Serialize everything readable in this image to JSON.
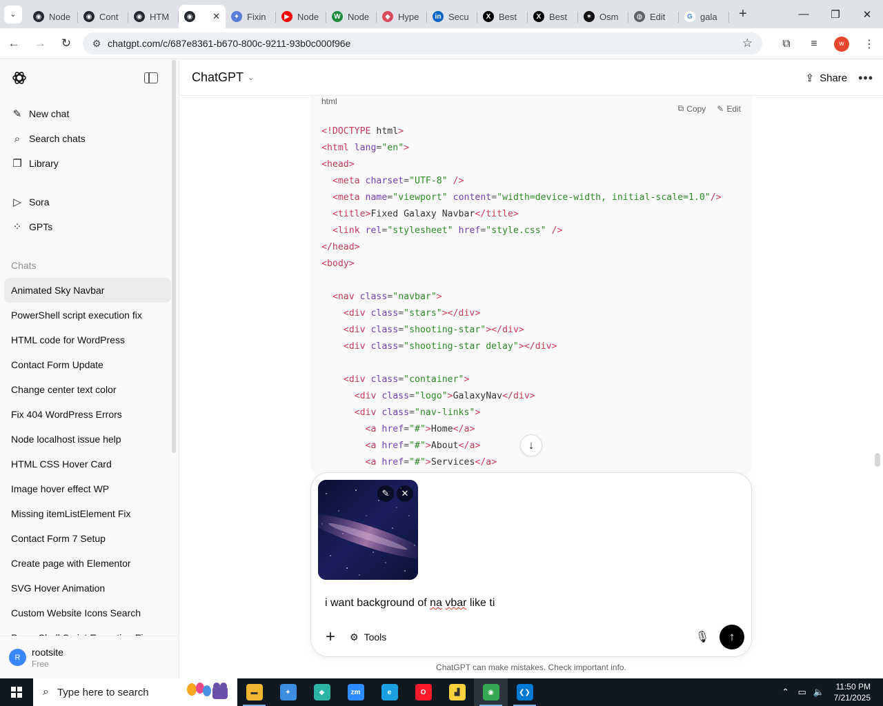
{
  "browser": {
    "tabs": [
      {
        "label": "Node",
        "fav_color": "#24292f",
        "fav_glyph": "◉",
        "icon": "github-icon"
      },
      {
        "label": "Cont",
        "fav_color": "#24292f",
        "fav_glyph": "◉",
        "icon": "github-icon"
      },
      {
        "label": "HTM",
        "fav_color": "#24292f",
        "fav_glyph": "◉",
        "icon": "github-icon"
      },
      {
        "label": "",
        "fav_color": "#24292f",
        "fav_glyph": "◉",
        "icon": "chatgpt-icon",
        "active": true
      },
      {
        "label": "Fixin",
        "fav_color": "#5a7bd6",
        "fav_glyph": "✦",
        "icon": "stackblitz-icon"
      },
      {
        "label": "Node",
        "fav_color": "#ff0000",
        "fav_glyph": "▶",
        "icon": "youtube-icon"
      },
      {
        "label": "Node",
        "fav_color": "#1e8e3e",
        "fav_glyph": "W",
        "icon": "w-icon"
      },
      {
        "label": "Hype",
        "fav_color": "#d84a5d",
        "fav_glyph": "◆",
        "icon": "hype-icon"
      },
      {
        "label": "Secu",
        "fav_color": "#0a66c2",
        "fav_glyph": "in",
        "icon": "linkedin-icon"
      },
      {
        "label": "Best",
        "fav_color": "#000000",
        "fav_glyph": "X",
        "icon": "x-icon"
      },
      {
        "label": "Best",
        "fav_color": "#000000",
        "fav_glyph": "X",
        "icon": "x-icon"
      },
      {
        "label": "Osm",
        "fav_color": "#111111",
        "fav_glyph": "✶",
        "icon": "osmo-icon"
      },
      {
        "label": "Edit",
        "fav_color": "#5f6368",
        "fav_glyph": "◍",
        "icon": "globe-icon"
      },
      {
        "label": "gala",
        "fav_color": "#ffffff",
        "fav_glyph": "G",
        "icon": "google-icon"
      }
    ],
    "url": "chatgpt.com/c/687e8361-b670-800c-9211-93b0c000f96e",
    "profile_initial": "w"
  },
  "sidebar": {
    "nav": [
      {
        "label": "New chat",
        "icon": "new-chat-icon",
        "glyph": "✎"
      },
      {
        "label": "Search chats",
        "icon": "search-icon",
        "glyph": "⌕"
      },
      {
        "label": "Library",
        "icon": "library-icon",
        "glyph": "❐"
      }
    ],
    "nav2": [
      {
        "label": "Sora",
        "icon": "sora-icon",
        "glyph": "▷"
      },
      {
        "label": "GPTs",
        "icon": "gpts-icon",
        "glyph": "⁘"
      }
    ],
    "chats_heading": "Chats",
    "chats": [
      "Animated Sky Navbar",
      "PowerShell script execution fix",
      "HTML code for WordPress",
      "Contact Form Update",
      "Change center text color",
      "Fix 404 WordPress Errors",
      "Node localhost issue help",
      "HTML CSS Hover Card",
      "Image hover effect WP",
      "Missing itemListElement Fix",
      "Contact Form 7 Setup",
      "Create page with Elementor",
      "SVG Hover Animation",
      "Custom Website Icons Search",
      "PowerShell Script Execution Fix"
    ],
    "user": {
      "initial": "R",
      "name": "rootsite",
      "plan": "Free"
    }
  },
  "main": {
    "model_label": "ChatGPT",
    "share_label": "Share",
    "code": {
      "lang": "html",
      "copy_label": "Copy",
      "edit_label": "Edit",
      "lines": [
        "<!DOCTYPE html>",
        "<html lang=\"en\">",
        "<head>",
        "  <meta charset=\"UTF-8\" />",
        "  <meta name=\"viewport\" content=\"width=device-width, initial-scale=1.0\"/>",
        "  <title>Fixed Galaxy Navbar</title>",
        "  <link rel=\"stylesheet\" href=\"style.css\" />",
        "</head>",
        "<body>",
        "",
        "  <nav class=\"navbar\">",
        "    <div class=\"stars\"></div>",
        "    <div class=\"shooting-star\"></div>",
        "    <div class=\"shooting-star delay\"></div>",
        "",
        "    <div class=\"container\">",
        "      <div class=\"logo\">GalaxyNav</div>",
        "      <div class=\"nav-links\">",
        "        <a href=\"#\">Home</a>",
        "        <a href=\"#\">About</a>",
        "        <a href=\"#\">Services</a>"
      ]
    },
    "composer": {
      "prompt_parts": [
        "i want background of ",
        "na",
        " ",
        "vbar",
        " like ti"
      ],
      "misspelt_parts": [
        1,
        3
      ],
      "tools_label": "Tools"
    },
    "disclaimer": "ChatGPT can make mistakes. Check important info."
  },
  "taskbar": {
    "search_placeholder": "Type here to search",
    "apps": [
      {
        "name": "file-explorer-icon",
        "color": "#f2b731",
        "glyph": "▬",
        "open": true
      },
      {
        "name": "app-icon-2",
        "color": "#3d8ee0",
        "glyph": "✦",
        "open": false
      },
      {
        "name": "app-icon-3",
        "color": "#2bb3a3",
        "glyph": "◆",
        "open": false
      },
      {
        "name": "zoom-icon",
        "color": "#2d8cff",
        "glyph": "zm",
        "open": false
      },
      {
        "name": "edge-icon",
        "color": "#1ba1e2",
        "glyph": "e",
        "open": false
      },
      {
        "name": "opera-icon",
        "color": "#ff1b2d",
        "glyph": "O",
        "open": false
      },
      {
        "name": "sticky-notes-icon",
        "color": "#f7d23e",
        "glyph": "▟",
        "open": false
      },
      {
        "name": "chrome-icon",
        "color": "#34a853",
        "glyph": "◉",
        "open": true,
        "focus": true
      },
      {
        "name": "vscode-icon",
        "color": "#0078d4",
        "glyph": "❮❯",
        "open": true
      }
    ],
    "time": "11:50 PM",
    "date": "7/21/2025"
  }
}
